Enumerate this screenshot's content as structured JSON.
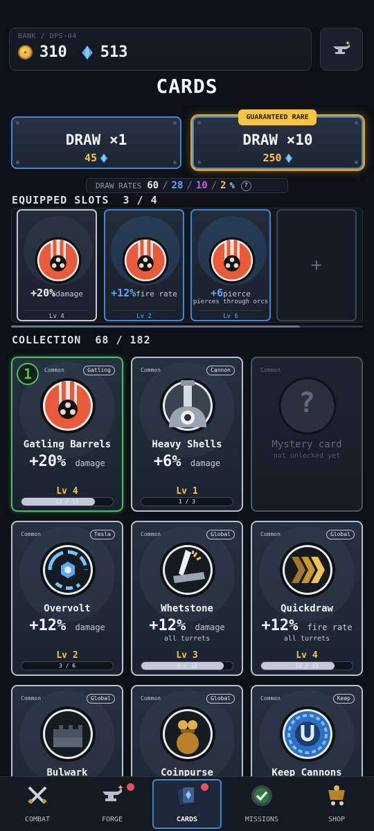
{
  "bank": {
    "label": "BANK / DPS-04",
    "gold": "310",
    "gems": "513"
  },
  "title": "CARDS",
  "draw_one": {
    "label": "DRAW ×1",
    "cost": "45"
  },
  "draw_ten": {
    "label": "DRAW ×10",
    "cost": "250",
    "badge": "GUARANTEED RARE"
  },
  "rates": {
    "label": "DRAW RATES",
    "common": "60",
    "rare": "28",
    "epic": "10",
    "legendary": "2",
    "unit": "%",
    "help": "?",
    "sep": "/"
  },
  "equipped": {
    "title": "EQUIPPED SLOTS",
    "count": "3 / 4",
    "slots": [
      {
        "stat": "+20%",
        "stat_label": "damage",
        "sub": "",
        "level": "Lv 4"
      },
      {
        "stat": "+12%",
        "stat_label": "fire rate",
        "sub": "",
        "level": "Lv 2"
      },
      {
        "stat": "+6",
        "stat_label": "pierce",
        "sub": "pierces through orcs",
        "level": "Lv 6"
      }
    ],
    "empty_symbol": "+",
    "scroll_fraction": 0.82
  },
  "collection": {
    "title": "COLLECTION",
    "count": "68 / 182",
    "cards": [
      {
        "rarity": "Common",
        "tag": "Gatling",
        "name": "Gatling Barrels",
        "stat": "+20%",
        "stat_label": "damage",
        "sub": "",
        "level": "Lv 4",
        "progress": "12 / 15",
        "fraction": 0.8,
        "equipped_index": "1",
        "icon": "gatling-icon"
      },
      {
        "rarity": "Common",
        "tag": "Cannon",
        "name": "Heavy Shells",
        "stat": "+6%",
        "stat_label": "damage",
        "sub": "",
        "level": "Lv 1",
        "progress": "1 / 3",
        "fraction": 0.33,
        "icon": "cannon-icon"
      },
      {
        "rarity": "Common",
        "name": "Mystery card",
        "sub": "not unlocked yet",
        "symbol": "?",
        "icon": "question-icon"
      },
      {
        "rarity": "Common",
        "tag": "Tesla",
        "name": "Overvolt",
        "stat": "+12%",
        "stat_label": "damage",
        "sub": "",
        "level": "Lv 2",
        "progress": "3 / 6",
        "fraction": 0.5,
        "icon": "tesla-icon"
      },
      {
        "rarity": "Common",
        "tag": "Global",
        "name": "Whetstone",
        "stat": "+12%",
        "stat_label": "damage",
        "sub": "all turrets",
        "level": "Lv 3",
        "progress": "9 / 10",
        "fraction": 0.9,
        "icon": "whetstone-icon"
      },
      {
        "rarity": "Common",
        "tag": "Global",
        "name": "Quickdraw",
        "stat": "+12%",
        "stat_label": "fire rate",
        "sub": "all turrets",
        "level": "Lv 4",
        "progress": "12 / 15",
        "fraction": 0.8,
        "icon": "chevrons-icon"
      },
      {
        "rarity": "Common",
        "tag": "Global",
        "name": "Bulwark",
        "icon": "wall-icon"
      },
      {
        "rarity": "Common",
        "tag": "Global",
        "name": "Coinpurse",
        "icon": "coin-pouch-icon"
      },
      {
        "rarity": "Common",
        "tag": "Keep",
        "name": "Keep Cannons",
        "icon": "keep-icon"
      }
    ]
  },
  "nav": [
    {
      "label": "COMBAT",
      "icon": "swords-icon"
    },
    {
      "label": "FORGE",
      "icon": "anvil-icon"
    },
    {
      "label": "CARDS",
      "icon": "cards-icon"
    },
    {
      "label": "MISSIONS",
      "icon": "check-icon"
    },
    {
      "label": "SHOP",
      "icon": "cart-icon"
    }
  ],
  "colors": {
    "accent_blue": "#3f88d8",
    "gold": "#f6c545",
    "selected_green": "#46c15b",
    "rare": "#5aa9ff",
    "epic": "#c85cf0",
    "notification": "#e94f5f"
  }
}
